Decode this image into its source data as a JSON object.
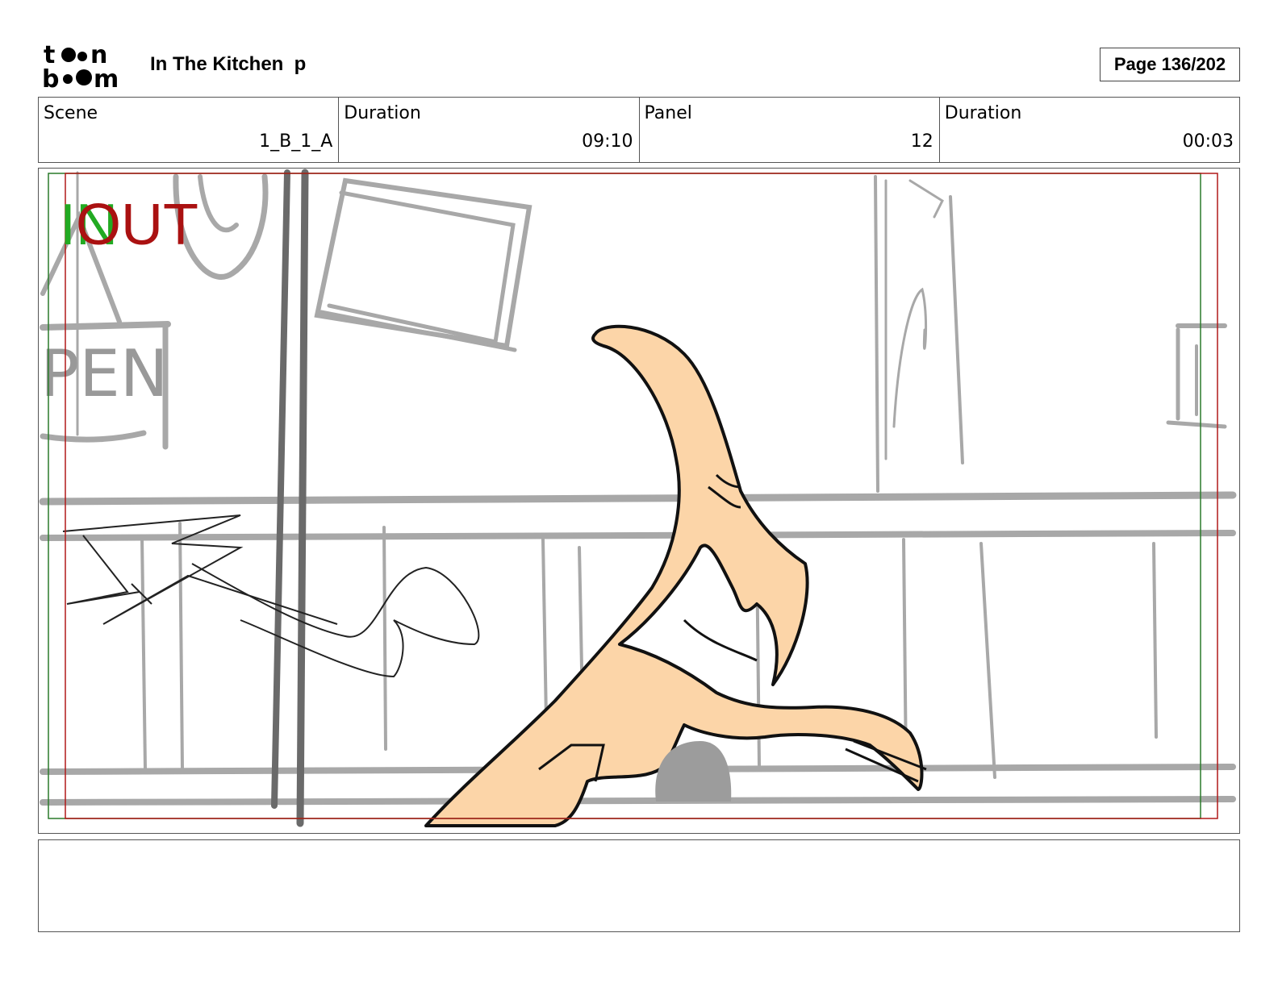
{
  "header": {
    "logo_text": "toon boom",
    "project_title": "In The Kitchen  p",
    "page_indicator": "Page 136/202"
  },
  "info": {
    "scene_label": "Scene",
    "scene_value": "1_B_1_A",
    "scene_duration_label": "Duration",
    "scene_duration_value": "09:10",
    "panel_label": "Panel",
    "panel_value": "12",
    "panel_duration_label": "Duration",
    "panel_duration_value": "00:03"
  },
  "panel": {
    "in_marker": "IN",
    "out_marker": "OUT",
    "sign_text": "PEN",
    "colors": {
      "in_marker": "#22aa22",
      "out_marker": "#aa1111",
      "skin": "#fcd5a8",
      "sketch_gray": "#a8a8a8",
      "ink": "#111111"
    }
  },
  "notes": {
    "text": ""
  }
}
